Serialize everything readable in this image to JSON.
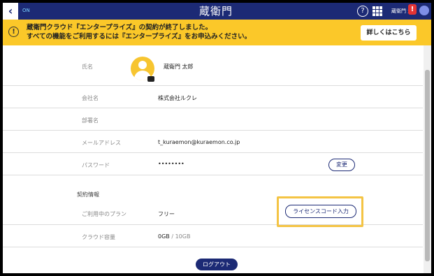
{
  "topbar": {
    "back_icon": "‹",
    "on_label": "ON",
    "logo": "蔵衛門",
    "help_icon": "?",
    "user_name": "蔵衛門 太",
    "notif_icon": "!"
  },
  "banner": {
    "line1": "蔵衛門クラウド『エンタープライズ』の契約が終了しました。",
    "line2": "すべての機能をご利用するには『エンタープライズ』をお申込みください。",
    "button": "詳しくはこちら",
    "icon": "!"
  },
  "profile": {
    "name_label": "氏名",
    "name_value": "蔵衛門 太郎",
    "company_label": "会社名",
    "company_value": "株式会社ルクレ",
    "dept_label": "部署名",
    "dept_value": "",
    "email_label": "メールアドレス",
    "email_value": "t_kuraemon@kuraemon.co.jp",
    "password_label": "パスワード",
    "password_value": "••••••••",
    "change_button": "変更"
  },
  "contract": {
    "section_title": "契約情報",
    "plan_label": "ご利用中のプラン",
    "plan_value": "フリー",
    "license_button": "ライセンスコード入力",
    "storage_label": "クラウド容量",
    "storage_used": "0GB",
    "storage_total": " / 10GB"
  },
  "logout_button": "ログアウト",
  "colors": {
    "navy": "#1c2a75",
    "banner": "#fbc829",
    "highlight": "#f4c444"
  }
}
